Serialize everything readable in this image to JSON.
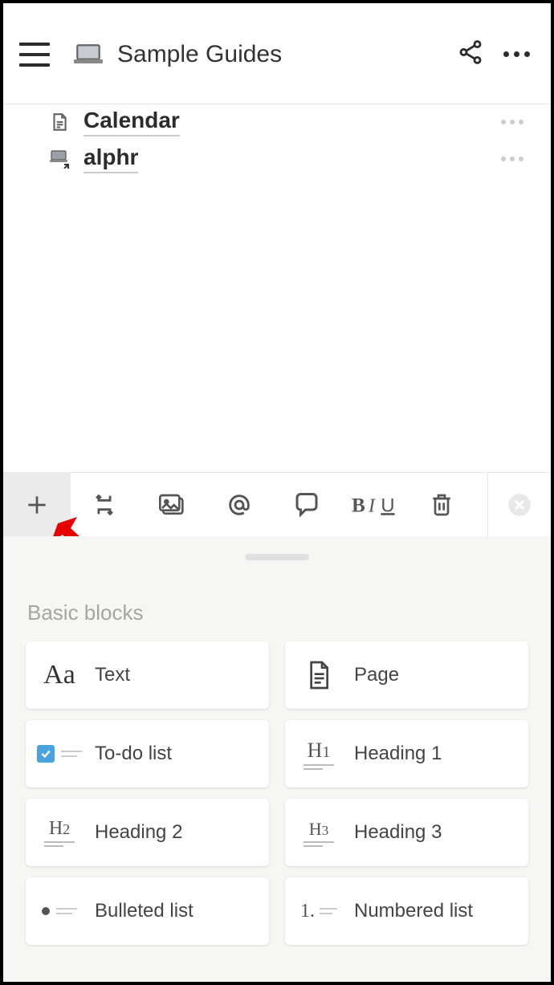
{
  "header": {
    "title": "Sample Guides"
  },
  "pages": [
    {
      "label": "Calendar",
      "icon": "page"
    },
    {
      "label": "alphr",
      "icon": "laptop-link"
    }
  ],
  "panel": {
    "section_title": "Basic blocks",
    "blocks": [
      {
        "label": "Text"
      },
      {
        "label": "Page"
      },
      {
        "label": "To-do list"
      },
      {
        "label": "Heading 1"
      },
      {
        "label": "Heading 2"
      },
      {
        "label": "Heading 3"
      },
      {
        "label": "Bulleted list"
      },
      {
        "label": "Numbered list"
      }
    ]
  }
}
